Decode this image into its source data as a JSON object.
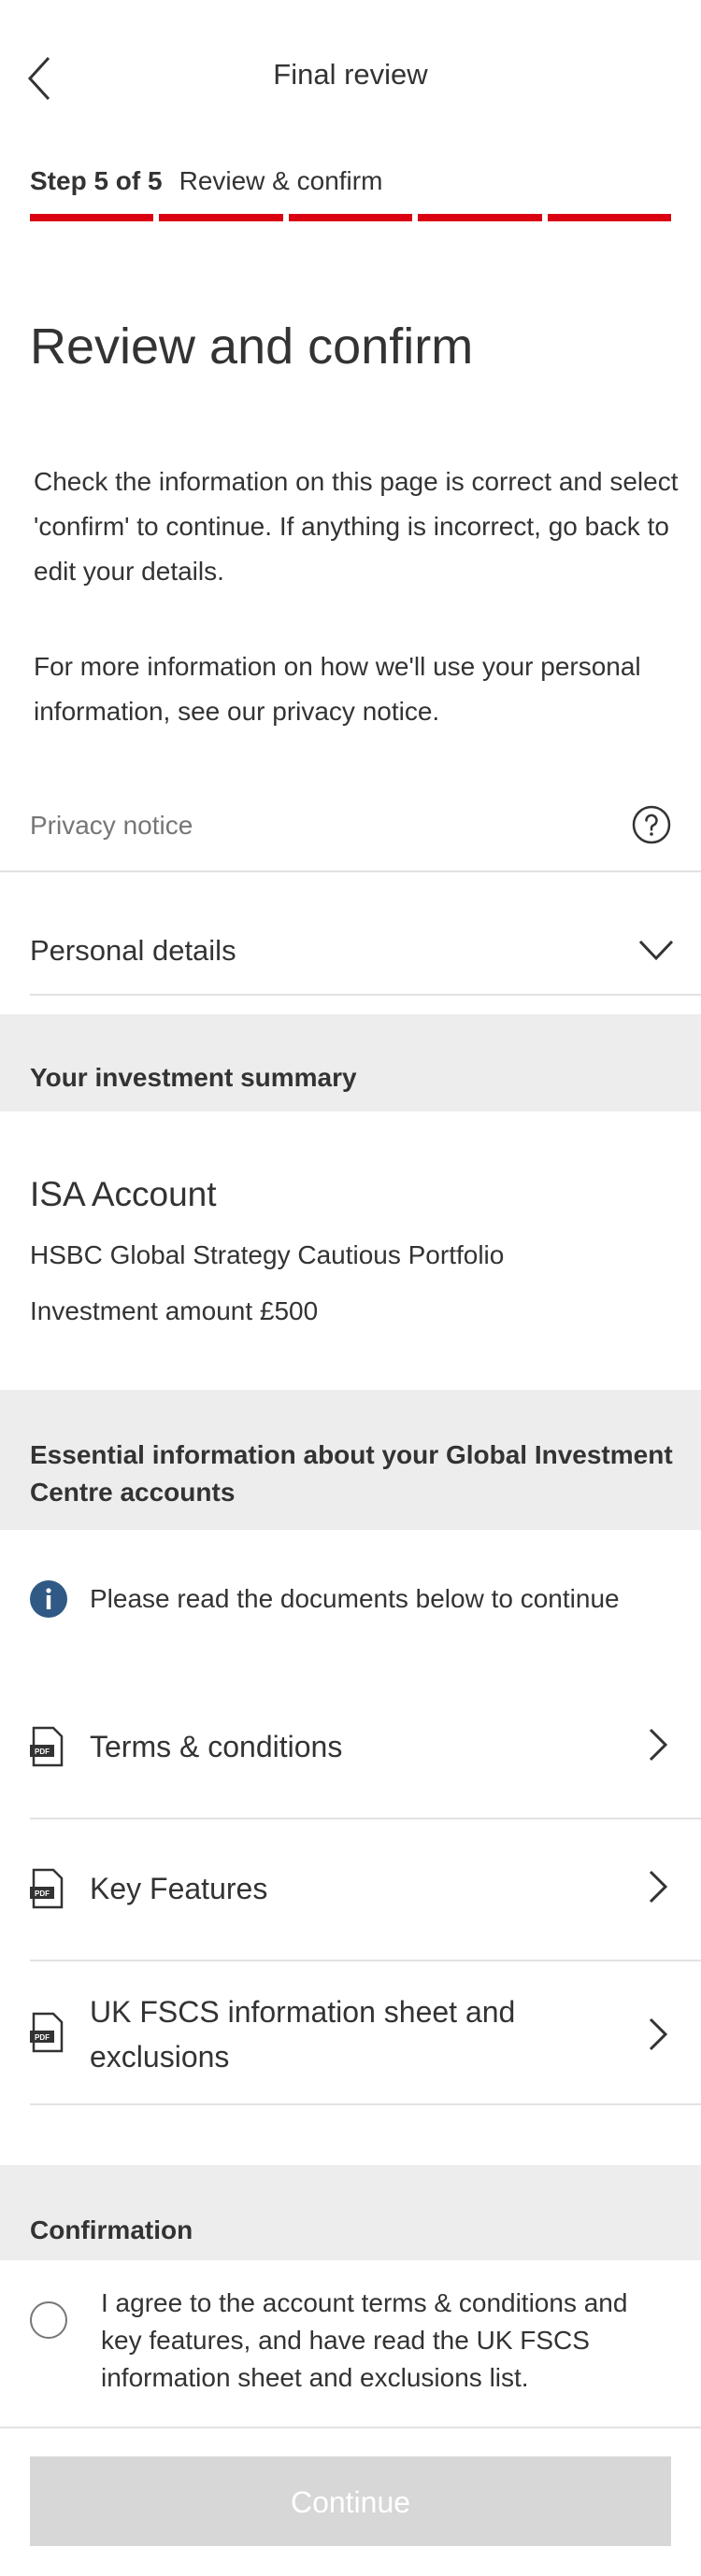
{
  "header": {
    "title": "Final review",
    "back_icon": "chevron-left-icon"
  },
  "step": {
    "count": "Step 5 of 5",
    "label": "Review & confirm",
    "total_steps": 5,
    "completed_steps": 5,
    "accent_color": "#db0011"
  },
  "main": {
    "title": "Review and confirm",
    "intro": "Check the information on this page is correct and select 'confirm' to continue. If anything is incorrect, go back to edit your details.",
    "privacy_info": "For more information on how we'll use your personal information, see our privacy notice.",
    "privacy_notice_label": "Privacy notice",
    "personal_details_label": "Personal details"
  },
  "investment_summary": {
    "heading": "Your investment summary",
    "account_type": "ISA Account",
    "fund_name": "HSBC Global Strategy Cautious Portfolio",
    "amount_text": "Investment amount £500"
  },
  "essential_info": {
    "heading": "Essential information about your Global Investment Centre accounts",
    "notice": "Please read the documents below to continue",
    "documents": [
      {
        "label": "Terms & conditions",
        "icon": "pdf-icon"
      },
      {
        "label": "Key Features",
        "icon": "pdf-icon"
      },
      {
        "label": "UK FSCS information sheet and exclusions",
        "icon": "pdf-icon"
      }
    ]
  },
  "confirmation": {
    "heading": "Confirmation",
    "agree_text": "I agree to the account terms & conditions and key features, and have read the UK FSCS information sheet and exclusions list.",
    "checked": false
  },
  "continue_label": "Continue"
}
